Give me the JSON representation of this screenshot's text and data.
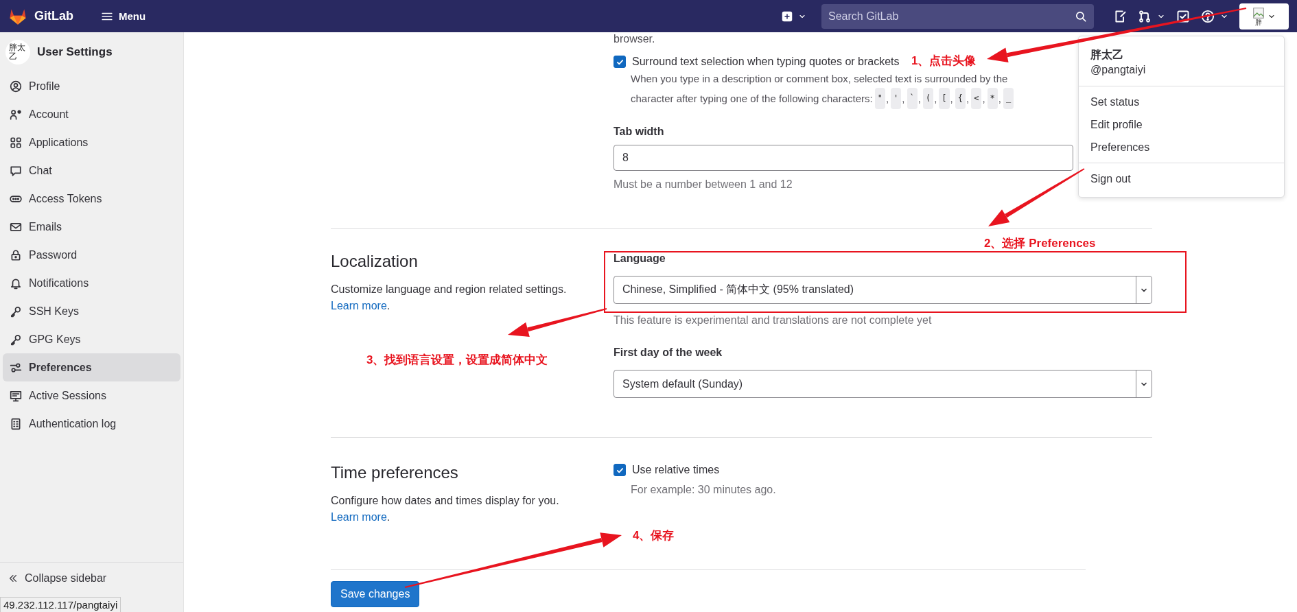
{
  "header": {
    "logo_text": "GitLab",
    "menu_label": "Menu",
    "search": {
      "placeholder": "Search GitLab"
    },
    "avatar_alt": "胖"
  },
  "sidebar": {
    "avatar_alt": "胖太乙",
    "title": "User Settings",
    "items": [
      {
        "label": "Profile",
        "selected": false
      },
      {
        "label": "Account",
        "selected": false
      },
      {
        "label": "Applications",
        "selected": false
      },
      {
        "label": "Chat",
        "selected": false
      },
      {
        "label": "Access Tokens",
        "selected": false
      },
      {
        "label": "Emails",
        "selected": false
      },
      {
        "label": "Password",
        "selected": false
      },
      {
        "label": "Notifications",
        "selected": false
      },
      {
        "label": "SSH Keys",
        "selected": false
      },
      {
        "label": "GPG Keys",
        "selected": false
      },
      {
        "label": "Preferences",
        "selected": true
      },
      {
        "label": "Active Sessions",
        "selected": false
      },
      {
        "label": "Authentication log",
        "selected": false
      }
    ],
    "collapse_label": "Collapse sidebar"
  },
  "behavior": {
    "cut_text": "browser.",
    "surround": {
      "label": "Surround text selection when typing quotes or brackets",
      "checked": true,
      "description_lines": [
        "When you type in a description or comment box, selected text is surrounded by the",
        "character after typing one of the following characters:"
      ],
      "chars": [
        "\"",
        "'",
        "`",
        "(",
        "[",
        "{",
        "<",
        "*",
        "_"
      ],
      "separator": ","
    },
    "tab_width": {
      "label": "Tab width",
      "value": "8",
      "hint": "Must be a number between 1 and 12"
    }
  },
  "localization": {
    "title": "Localization",
    "description": "Customize language and region related settings.",
    "link": "Learn more",
    "link_suffix": ".",
    "language": {
      "label": "Language",
      "value": "Chinese, Simplified - 简体中文 (95% translated)",
      "hint": "This feature is experimental and translations are not complete yet"
    },
    "first_day": {
      "label": "First day of the week",
      "value": "System default (Sunday)"
    }
  },
  "time_preferences": {
    "title": "Time preferences",
    "description": "Configure how dates and times display for you.",
    "link": "Learn more",
    "link_suffix": ".",
    "relative_times": {
      "label": "Use relative times",
      "checked": true,
      "hint": "For example: 30 minutes ago."
    }
  },
  "save_button": "Save changes",
  "user_menu": {
    "name": "胖太乙",
    "username": "@pangtaiyi",
    "groups": [
      [
        "Set status",
        "Edit profile",
        "Preferences"
      ],
      [
        "Sign out"
      ]
    ]
  },
  "status_url": "49.232.112.117/pangtaiyi",
  "annotations": [
    {
      "kind": "step",
      "text": "1、点击头像"
    },
    {
      "kind": "step",
      "text": "2、选择 Preferences"
    },
    {
      "kind": "step",
      "text": "3、找到语言设置，设置成简体中文"
    },
    {
      "kind": "step",
      "text": "4、保存"
    }
  ]
}
